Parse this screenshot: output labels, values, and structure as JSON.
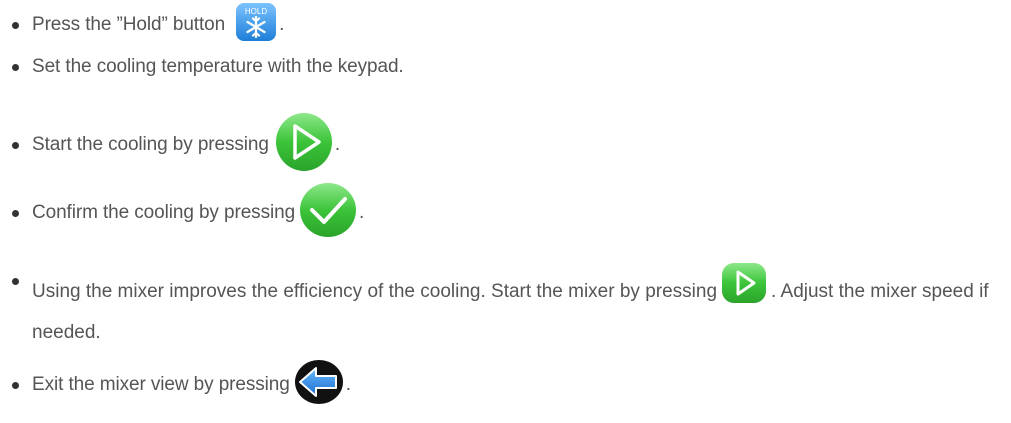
{
  "steps": [
    {
      "text": "Press the ”Hold” button",
      "suffix": ".",
      "icon": "hold-snowflake-icon",
      "icon_label": "HOLD"
    },
    {
      "text": "Set the cooling temperature with the keypad."
    },
    {
      "text": "Start the cooling by pressing",
      "suffix": ".",
      "icon": "play-circle-icon"
    },
    {
      "text": "Confirm the cooling by pressing",
      "suffix": ".",
      "icon": "checkmark-circle-icon"
    },
    {
      "text_before": "Using the mixer improves the efficiency of the cooling. Start the mixer by pressing",
      "text_after": ". Adjust the mixer speed if needed.",
      "icon": "play-square-icon"
    },
    {
      "text": "Exit the mixer view by pressing",
      "suffix": ".",
      "icon": "back-arrow-icon"
    }
  ],
  "colors": {
    "text": "#555555",
    "bullet": "#333333",
    "hold_blue": "#2f8fe0",
    "green": "#3cc43a",
    "back_black": "#111111",
    "back_blue": "#2a8ae6"
  }
}
